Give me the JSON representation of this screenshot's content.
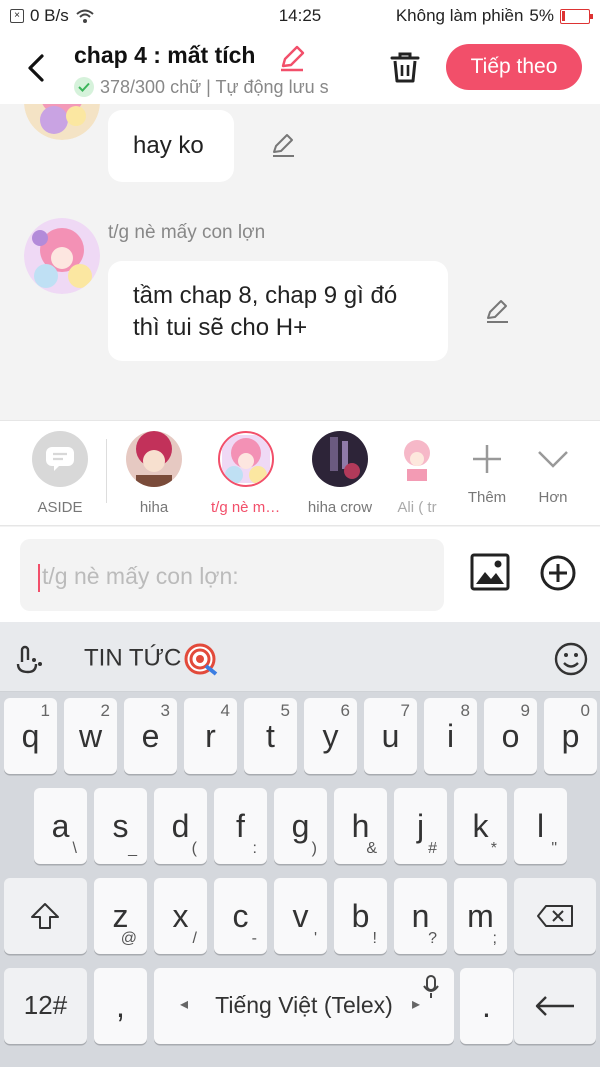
{
  "status": {
    "speed": "0 B/s",
    "time": "14:25",
    "dnd": "Không làm phiền",
    "battery": "5%"
  },
  "header": {
    "title": "chap 4 : mất tích",
    "subtitle": "378/300 chữ | Tự động lưu s",
    "next_label": "Tiếp theo"
  },
  "chat": {
    "msg1": "hay ko",
    "sender2": "t/g nè mấy con lợn",
    "msg2_line1": "tầm chap 8, chap 9 gì đó",
    "msg2_line2": "thì tui sẽ cho H+"
  },
  "characters": [
    {
      "label": "ASIDE"
    },
    {
      "label": "hiha"
    },
    {
      "label": "t/g nè mấ..."
    },
    {
      "label": "hiha crow"
    },
    {
      "label": "Ali ( tr"
    }
  ],
  "char_more": "Thêm",
  "char_less": "Hơn",
  "input": {
    "placeholder": "t/g nè mấy con lợn:"
  },
  "keyboard": {
    "news": "TIN TỨC",
    "row1": [
      [
        "q",
        "1"
      ],
      [
        "w",
        "2"
      ],
      [
        "e",
        "3"
      ],
      [
        "r",
        "4"
      ],
      [
        "t",
        "5"
      ],
      [
        "y",
        "6"
      ],
      [
        "u",
        "7"
      ],
      [
        "i",
        "8"
      ],
      [
        "o",
        "9"
      ],
      [
        "p",
        "0"
      ]
    ],
    "row2": [
      [
        "a",
        "\\"
      ],
      [
        "s",
        "_"
      ],
      [
        "d",
        "("
      ],
      [
        "f",
        ":"
      ],
      [
        "g",
        ")"
      ],
      [
        "h",
        "&"
      ],
      [
        "j",
        "#"
      ],
      [
        "k",
        "*"
      ],
      [
        "l",
        "\""
      ]
    ],
    "row3": [
      [
        "z",
        "@"
      ],
      [
        "x",
        "/"
      ],
      [
        "c",
        "-"
      ],
      [
        "v",
        "'"
      ],
      [
        "b",
        "!"
      ],
      [
        "n",
        "?"
      ],
      [
        "m",
        ";"
      ]
    ],
    "num_label": "12#",
    "comma": ",",
    "space_label": "Tiếng Việt (Telex)",
    "period": "."
  },
  "colors": {
    "accent": "#f24f6a",
    "check": "#3cb55b"
  }
}
